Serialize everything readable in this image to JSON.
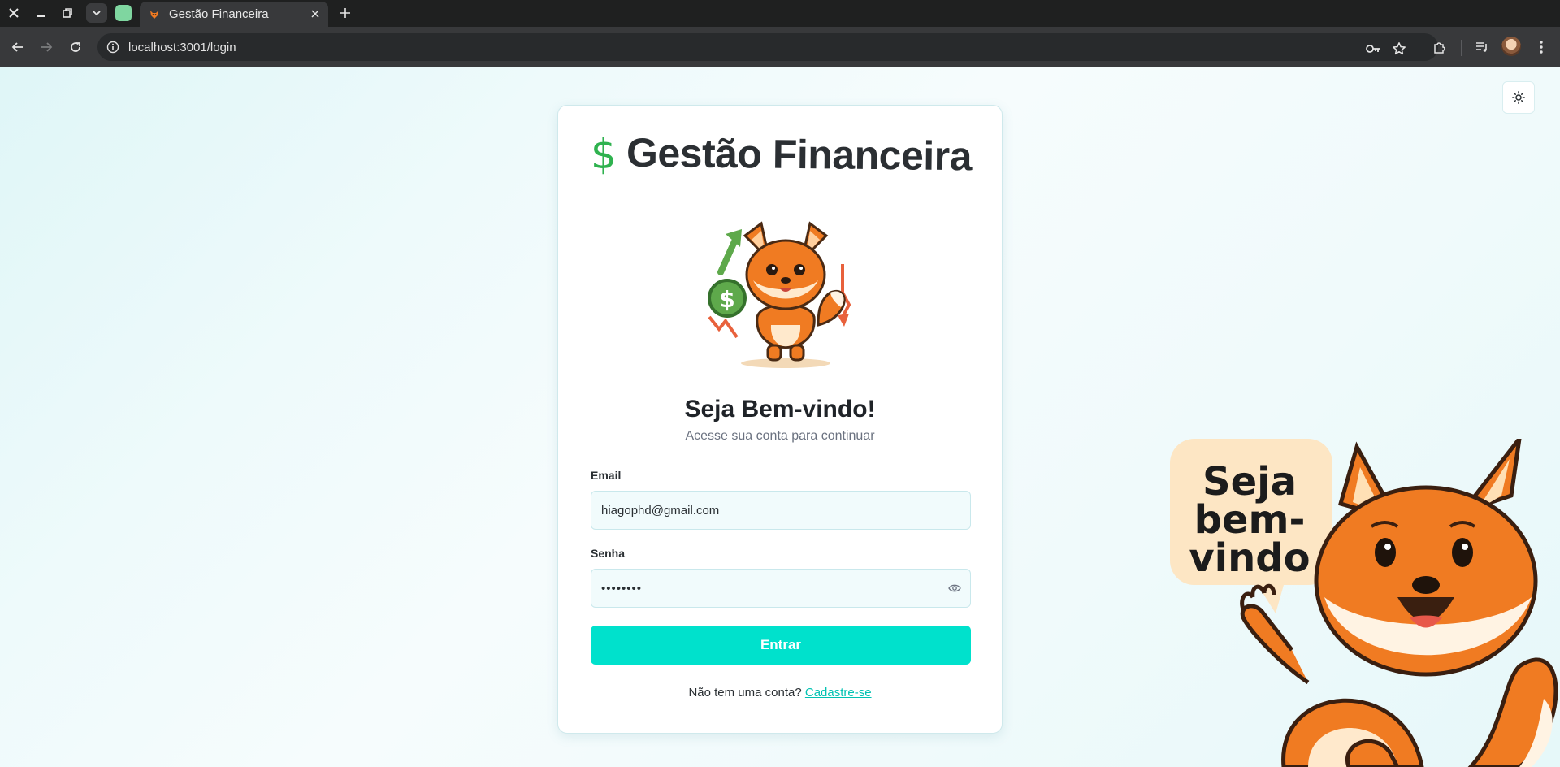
{
  "browser": {
    "tab_title": "Gestão Financeira",
    "url": "localhost:3001/login"
  },
  "brand": {
    "symbol": "$",
    "name": "Gestão Financeira",
    "accent_color": "#2fb24f"
  },
  "welcome": {
    "title": "Seja Bem-vindo!",
    "subtitle": "Acesse sua conta para continuar"
  },
  "form": {
    "email_label": "Email",
    "email_value": "hiagophd@gmail.com",
    "password_label": "Senha",
    "password_value": "••••••••",
    "submit_label": "Entrar",
    "submit_color": "#00e1cc"
  },
  "signup": {
    "prompt": "Não tem uma conta?",
    "link": "Cadastre-se"
  },
  "speech_bubble": {
    "line1": "Seja",
    "line2": "bem-",
    "line3": "vindo"
  }
}
